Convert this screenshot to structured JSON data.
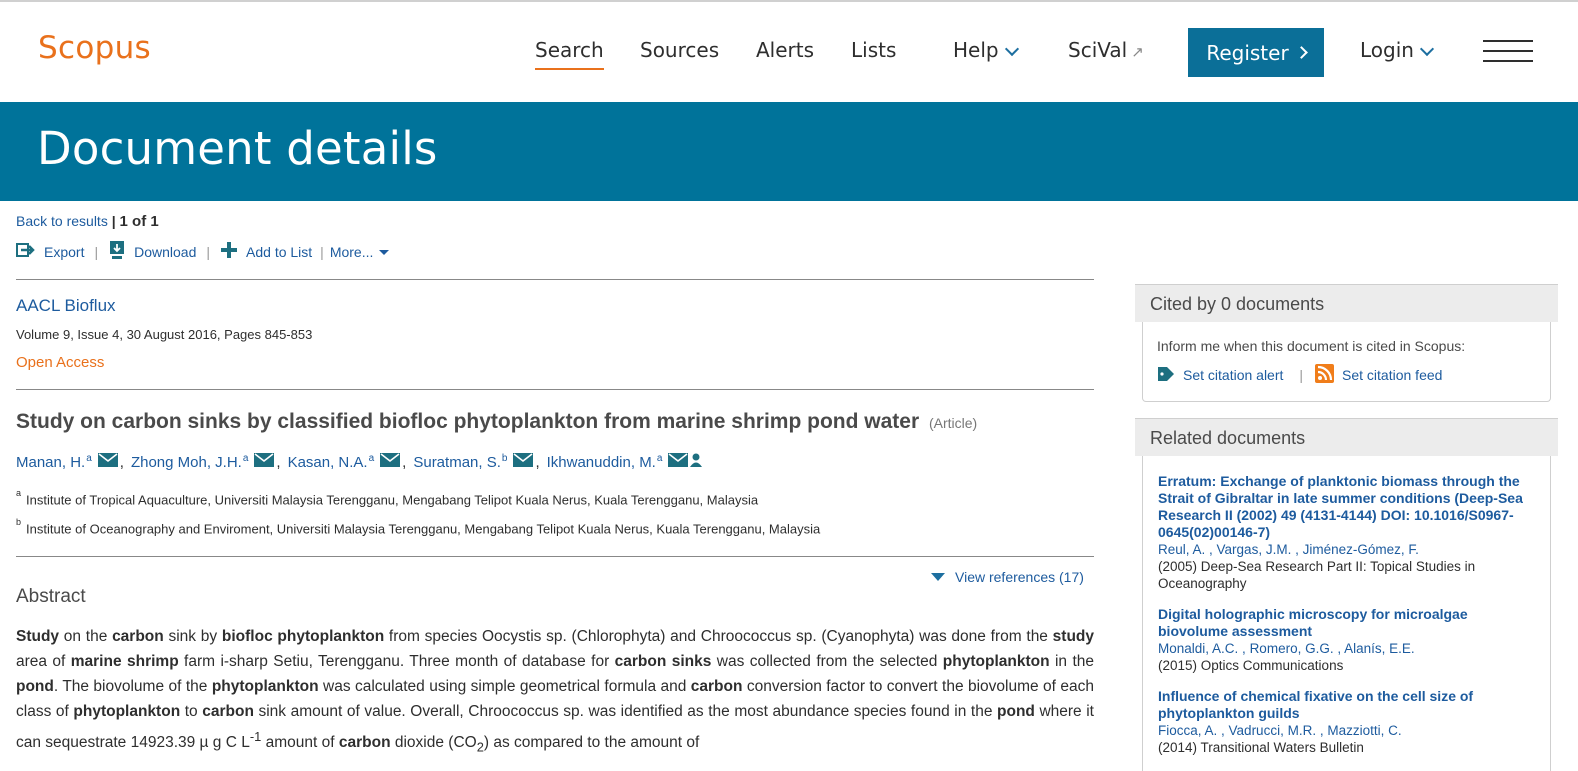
{
  "nav": {
    "logo": "Scopus",
    "items": [
      "Search",
      "Sources",
      "Alerts",
      "Lists",
      "Help",
      "SciVal"
    ],
    "register": "Register",
    "login": "Login"
  },
  "banner": {
    "title": "Document details"
  },
  "toolbar": {
    "back": "Back to results",
    "count": "1 of 1",
    "export": "Export",
    "download": "Download",
    "add_to_list": "Add to List",
    "more": "More..."
  },
  "document": {
    "source_title": "AACL Bioflux",
    "volume_info": "Volume 9, Issue 4, 30 August 2016, Pages 845-853",
    "open_access": "Open Access",
    "title": "Study on carbon sinks by classified biofloc phytoplankton from marine shrimp pond water",
    "type": "(Article)",
    "authors": [
      {
        "name": "Manan, H.",
        "sup": "a"
      },
      {
        "name": "Zhong Moh, J.H.",
        "sup": "a"
      },
      {
        "name": "Kasan, N.A.",
        "sup": "a"
      },
      {
        "name": "Suratman, S.",
        "sup": "b"
      },
      {
        "name": "Ikhwanuddin, M.",
        "sup": "a"
      }
    ],
    "affiliations": [
      {
        "sup": "a",
        "text": "Institute of Tropical Aquaculture, Universiti Malaysia Terengganu, Mengabang Telipot Kuala Nerus, Kuala Terengganu, Malaysia"
      },
      {
        "sup": "b",
        "text": "Institute of Oceanography and Enviroment, Universiti Malaysia Terengganu, Mengabang Telipot Kuala Nerus, Kuala Terengganu, Malaysia"
      }
    ],
    "view_references": "View references (17)",
    "abstract_heading": "Abstract",
    "abstract_html": "<b>Study</b> on the <b>carbon</b> sink by <b>biofloc phytoplankton</b> from species Oocystis sp. (Chlorophyta) and Chroococcus sp. (Cyanophyta) was done from the <b>study</b> area of <b>marine shrimp</b> farm i-sharp Setiu, Terengganu. Three month of database for <b>carbon sinks</b> was collected from the selected <b>phytoplankton</b> in the <b>pond</b>. The biovolume of the <b>phytoplankton</b> was calculated using simple geometrical formula and <b>carbon</b> conversion factor to convert the biovolume of each class of <b>phytoplankton</b> to <b>carbon</b> sink amount of value. Overall, Chroococcus sp. was identified as the most abundance species found in the <b>pond</b> where it can sequestrate 14923.39 µ g C L<sup>-1</sup> amount of <b>carbon</b> dioxide (CO<sub>2</sub>) as compared to the amount of"
  },
  "cited_by": {
    "heading": "Cited by 0 documents",
    "inform": "Inform me when this document is cited in Scopus:",
    "set_alert": "Set citation alert",
    "set_feed": "Set citation feed"
  },
  "related": {
    "heading": "Related documents",
    "items": [
      {
        "title": "Erratum: Exchange of planktonic biomass through the Strait of Gibraltar in late summer conditions (Deep-Sea Research II (2002) 49 (4131-4144) DOI: 10.1016/S0967-0645(02)00146-7)",
        "authors": [
          "Reul, A.",
          "Vargas, J.M.",
          "Jiménez-Gómez, F."
        ],
        "source": "(2005) Deep-Sea Research Part II: Topical Studies in Oceanography"
      },
      {
        "title": "Digital holographic microscopy for microalgae biovolume assessment",
        "authors": [
          "Monaldi, A.C.",
          "Romero, G.G.",
          "Alanís, E.E."
        ],
        "source": "(2015) Optics Communications"
      },
      {
        "title": "Influence of chemical fixative on the cell size of phytoplankton guilds",
        "authors": [
          "Fiocca, A.",
          "Vadrucci, M.R.",
          "Mazziotti, C."
        ],
        "source": "(2014) Transitional Waters Bulletin"
      }
    ]
  },
  "colors": {
    "brand_orange": "#e9711c",
    "banner_teal": "#00739a",
    "register_blue": "#0b6f98",
    "link_blue": "#1d5b9e"
  }
}
